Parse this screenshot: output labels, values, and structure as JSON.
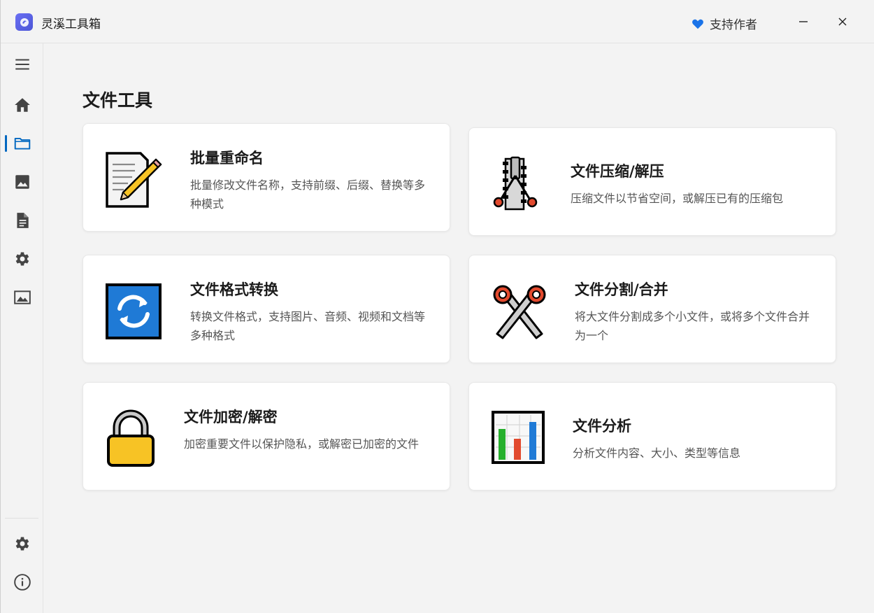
{
  "app": {
    "title": "灵溪工具箱",
    "support_label": "支持作者",
    "minimize": "−",
    "close": "✕"
  },
  "sidebar": {
    "items": [
      {
        "name": "menu",
        "icon": "hamburger-menu-icon"
      },
      {
        "name": "home",
        "icon": "home-icon"
      },
      {
        "name": "files",
        "icon": "folder-icon",
        "active": true
      },
      {
        "name": "images",
        "icon": "image-icon"
      },
      {
        "name": "documents",
        "icon": "document-icon"
      },
      {
        "name": "settings-tools",
        "icon": "gear-icon"
      },
      {
        "name": "gallery",
        "icon": "picture-frame-icon"
      }
    ],
    "footer": [
      {
        "name": "settings",
        "icon": "gear-icon"
      },
      {
        "name": "about",
        "icon": "info-icon"
      }
    ]
  },
  "page": {
    "title": "文件工具"
  },
  "tools": [
    {
      "title": "批量重命名",
      "desc": "批量修改文件名称，支持前缀、后缀、替换等多种模式",
      "icon": "notepad-pencil-icon"
    },
    {
      "title": "文件压缩/解压",
      "desc": "压缩文件以节省空间，或解压已有的压缩包",
      "icon": "zipper-icon"
    },
    {
      "title": "文件格式转换",
      "desc": "转换文件格式，支持图片、音频、视频和文档等多种格式",
      "icon": "refresh-arrows-icon"
    },
    {
      "title": "文件分割/合并",
      "desc": "将大文件分割成多个小文件，或将多个文件合并为一个",
      "icon": "scissors-icon"
    },
    {
      "title": "文件加密/解密",
      "desc": "加密重要文件以保护隐私，或解密已加密的文件",
      "icon": "padlock-icon"
    },
    {
      "title": "文件分析",
      "desc": "分析文件内容、大小、类型等信息",
      "icon": "bar-chart-icon"
    }
  ],
  "colors": {
    "accent": "#0067c0",
    "heart": "#1a73e8"
  }
}
